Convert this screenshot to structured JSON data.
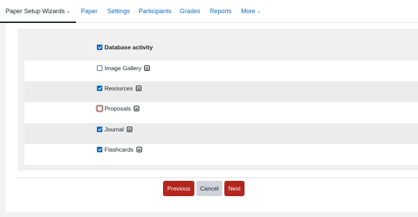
{
  "nav": {
    "tabs": [
      {
        "label": "Paper Setup Wizards",
        "active": true,
        "has_dropdown": true
      },
      {
        "label": "Paper"
      },
      {
        "label": "Settings"
      },
      {
        "label": "Participants"
      },
      {
        "label": "Grades"
      },
      {
        "label": "Reports"
      },
      {
        "label": "More",
        "has_dropdown": true
      }
    ],
    "chevron_icon": "chevron-down-icon"
  },
  "form": {
    "items": [
      {
        "label": "Database activity",
        "checked": true,
        "bold": true
      },
      {
        "label": "Image Gallery",
        "checked": false,
        "icon": "database-icon"
      },
      {
        "label": "Resources",
        "checked": true,
        "icon": "database-icon"
      },
      {
        "label": "Proposals",
        "checked": false,
        "focused": true,
        "icon": "database-icon"
      },
      {
        "label": "Journal",
        "checked": true,
        "icon": "database-icon"
      },
      {
        "label": "Flashcards",
        "checked": true,
        "icon": "database-icon"
      }
    ]
  },
  "buttons": {
    "previous": "Previous",
    "cancel": "Cancel",
    "next": "Next"
  },
  "colors": {
    "primary_button": "#b3261e",
    "secondary_button": "#ced4da",
    "link": "#0f6cbf",
    "checkbox": "#0f6cbf"
  }
}
